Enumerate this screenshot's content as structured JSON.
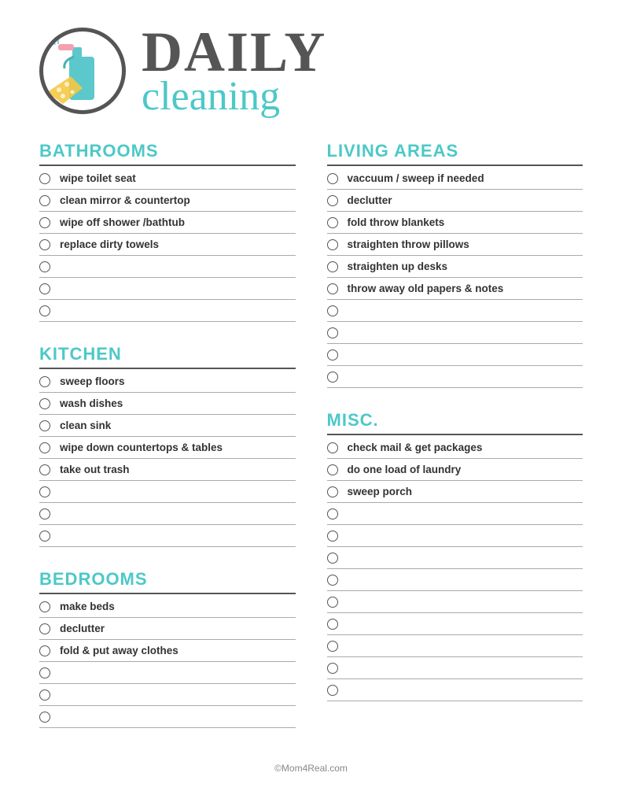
{
  "header": {
    "title_main": "DAILY",
    "title_sub": "cleaning"
  },
  "sections": {
    "left": [
      {
        "id": "bathrooms",
        "title": "BATHROOMS",
        "items": [
          "wipe toilet seat",
          "clean mirror & countertop",
          "wipe off shower /bathtub",
          "replace dirty towels",
          "",
          "",
          ""
        ]
      },
      {
        "id": "kitchen",
        "title": "KITCHEN",
        "items": [
          "sweep floors",
          "wash dishes",
          "clean sink",
          "wipe down countertops & tables",
          "take out trash",
          "",
          "",
          ""
        ]
      },
      {
        "id": "bedrooms",
        "title": "BEDROOMS",
        "items": [
          "make beds",
          "declutter",
          "fold & put away clothes",
          "",
          "",
          ""
        ]
      }
    ],
    "right": [
      {
        "id": "living-areas",
        "title": "LIVING AREAS",
        "items": [
          "vaccuum / sweep if needed",
          "declutter",
          "fold throw blankets",
          "straighten throw pillows",
          "straighten up desks",
          "throw away old papers & notes",
          "",
          "",
          "",
          ""
        ]
      },
      {
        "id": "misc",
        "title": "MISC.",
        "items": [
          "check mail & get packages",
          "do one load of laundry",
          "sweep porch",
          "",
          "",
          "",
          "",
          "",
          "",
          "",
          "",
          ""
        ]
      }
    ]
  },
  "footer": {
    "text": "©Mom4Real.com"
  }
}
